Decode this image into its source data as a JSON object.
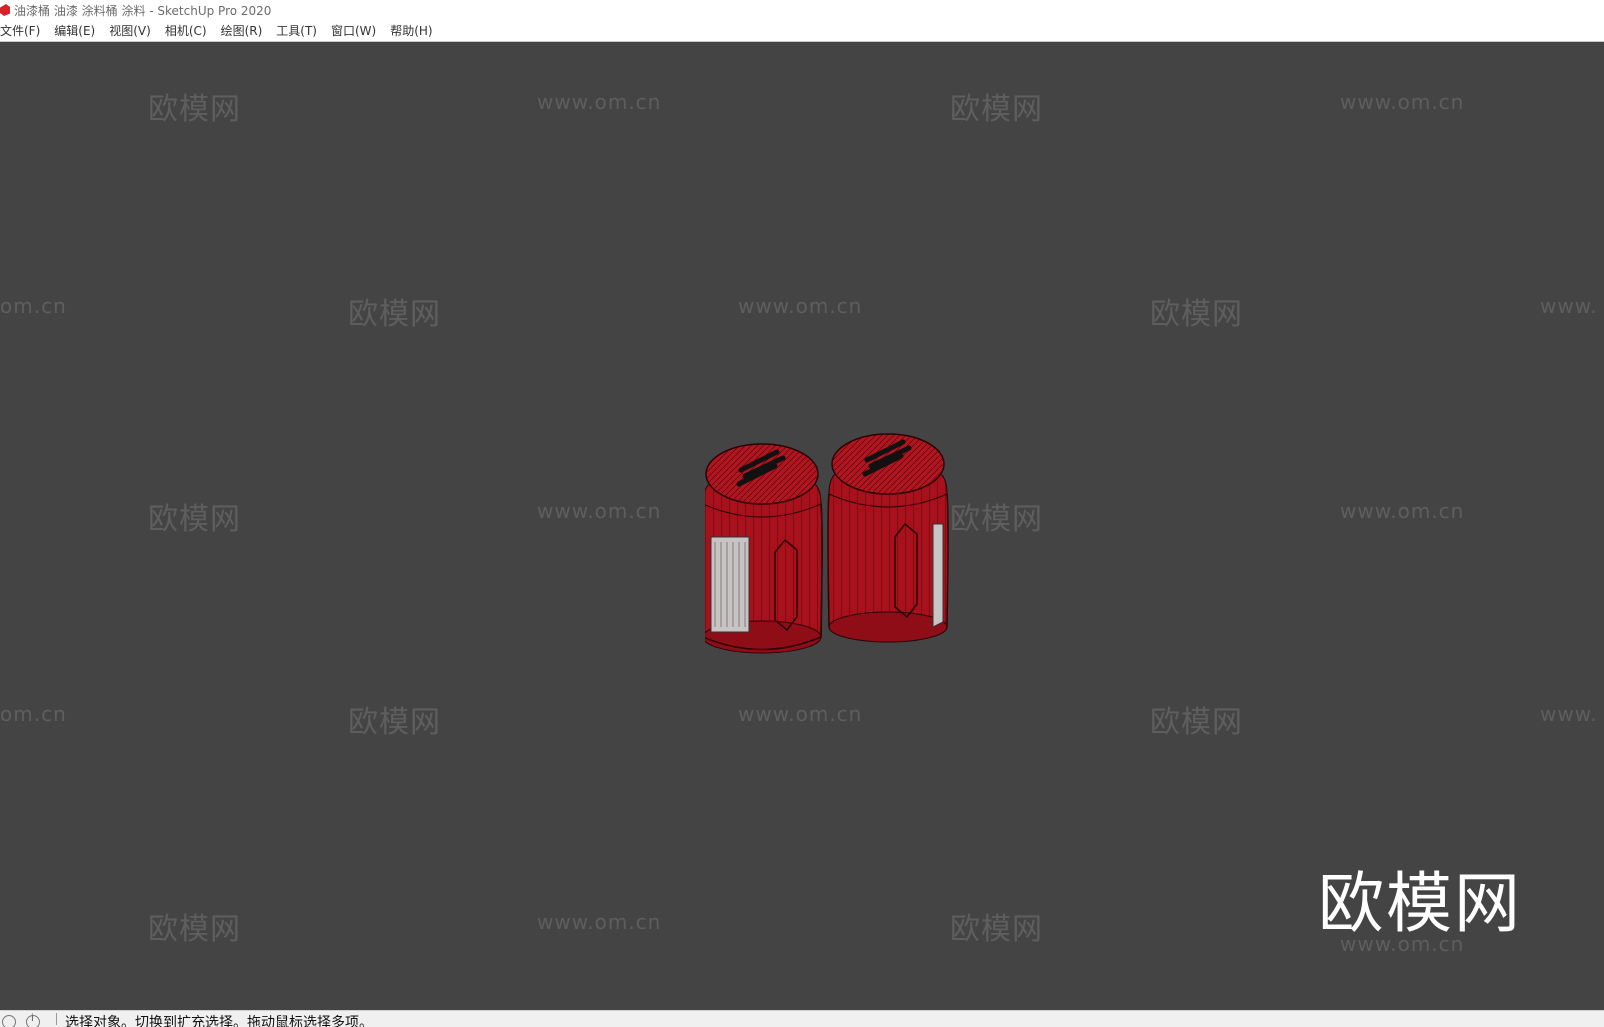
{
  "window": {
    "title": "油漆桶 油漆 涂料桶 涂料 - SketchUp Pro 2020"
  },
  "menubar": {
    "items": [
      "文件(F)",
      "编辑(E)",
      "视图(V)",
      "相机(C)",
      "绘图(R)",
      "工具(T)",
      "窗口(W)",
      "帮助(H)"
    ]
  },
  "watermarks": {
    "brand": "欧模网",
    "url": "www.om.cn",
    "url_partial_left": "om.cn",
    "url_partial_right": "www."
  },
  "statusbar": {
    "text": "选择对象。切换到扩充选择。拖动鼠标选择多项。"
  },
  "colors": {
    "viewport": "#444444",
    "model_red": "#b3121e"
  }
}
